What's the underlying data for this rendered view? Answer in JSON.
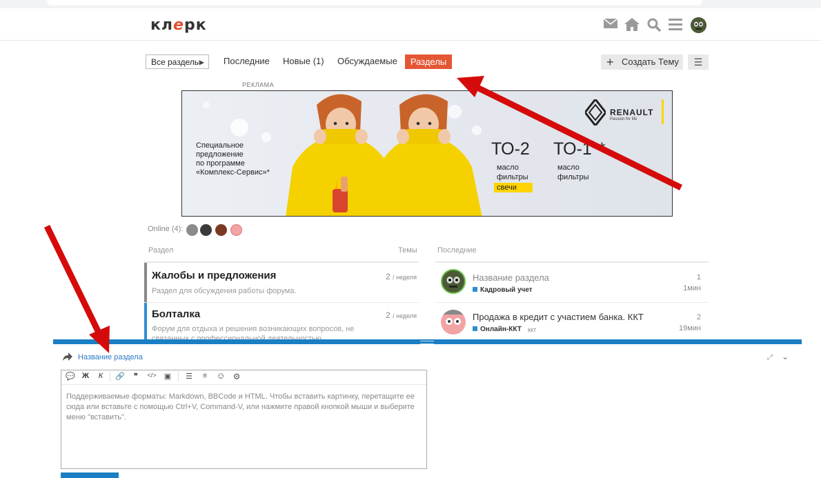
{
  "header": {
    "logo_left": "кл",
    "logo_accent": "е",
    "logo_right": "рк"
  },
  "nav": {
    "sections_dropdown": "Все разделы",
    "latest": "Последние",
    "new": "Новые (1)",
    "discussed": "Обсуждаемые",
    "categories": "Разделы",
    "create_topic": "Создать Тему"
  },
  "ad": {
    "label": "РЕКЛАМА",
    "brand": "RENAULT",
    "slogan": "Passion for life",
    "promo_line1": "Специальное",
    "promo_line2": "предложение",
    "promo_line3": "по программе",
    "promo_line4": "«Комплекс-Сервис»*",
    "to2": "ТО-2",
    "to1": "ТО-1**",
    "oil": "масло",
    "filters": "фильтры",
    "plugs": "свечи",
    "colors": {
      "accent_yellow": "#ffd400",
      "sweater": "#f5d100"
    }
  },
  "online": {
    "label": "Online (4):"
  },
  "categories_table": {
    "col_section": "Раздел",
    "col_topics": "Темы",
    "rows": [
      {
        "title": "Жалобы и предложения",
        "desc": "Раздел для обсуждения работы форума.",
        "count": "2",
        "period": "/ неделя",
        "color": "#888888"
      },
      {
        "title": "Болталка",
        "desc": "Форум для отдыха и решения возникающих вопросов, не связанных с профессиональной деятельностью.",
        "count": "2",
        "period": "/ неделя",
        "color": "#2e8fd1"
      }
    ]
  },
  "latest_table": {
    "col_latest": "Последние",
    "rows": [
      {
        "title": "Название раздела",
        "category": "Кадровый учет",
        "tag": "",
        "replies": "1",
        "age": "1мин"
      },
      {
        "title": "Продажа в кредит с участием банка. ККТ",
        "category": "Онлайн-ККТ",
        "tag": "ккт",
        "replies": "2",
        "age": "19мин"
      }
    ]
  },
  "composer": {
    "reply_to": "Название раздела",
    "toolbar": {
      "quote": "💬",
      "bold": "Ж",
      "italic": "К",
      "link": "🔗",
      "blockquote": "❞",
      "code": "</>",
      "image": "▣",
      "bullets": "☰",
      "numbers": "≡",
      "emoji": "☺",
      "options": "⚙"
    },
    "placeholder": "Поддерживаемые форматы: Markdown, BBCode и HTML. Чтобы вставить картинку, перетащите ее сюда или вставьте с помощью Ctrl+V, Command-V, или нажмите правой кнопкой мыши и выберите меню \"вставить\"."
  },
  "theme": {
    "brand": "#e45735",
    "link": "#1a7fc4"
  }
}
